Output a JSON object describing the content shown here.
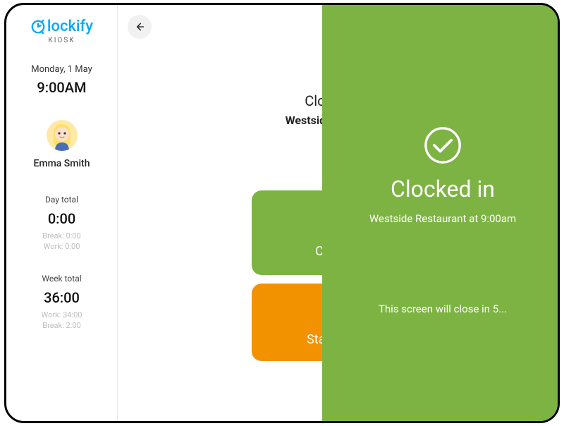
{
  "brand": {
    "name": "lockify",
    "sub": "KIOSK"
  },
  "sidebar": {
    "date": "Monday, 1 May",
    "time": "9:00AM",
    "user": "Emma Smith",
    "day": {
      "label": "Day total",
      "value": "0:00",
      "break": "Break: 0:00",
      "work": "Work: 0:00"
    },
    "week": {
      "label": "Week total",
      "value": "36:00",
      "work": "Work: 34:00",
      "break": "Break: 2:00"
    }
  },
  "main": {
    "heading": "Clock in to",
    "location": "Westside Restaurant",
    "clockin_label": "Clock in",
    "break_label": "Start break"
  },
  "overlay": {
    "title": "Clocked in",
    "sub": "Westside Restaurant at 9:00am",
    "closing": "This screen will close in 5..."
  }
}
